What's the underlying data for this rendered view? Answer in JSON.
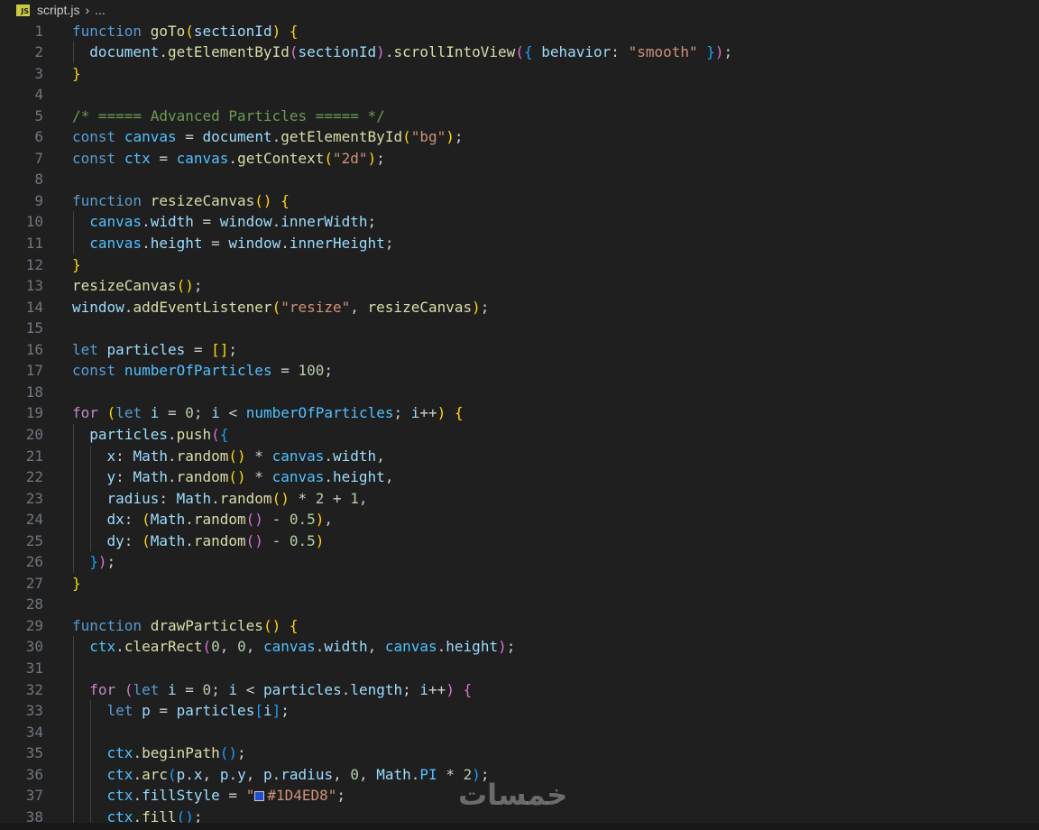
{
  "breadcrumb": {
    "file_icon_label": "JS",
    "file": "script.js",
    "separator": "›",
    "rest": "..."
  },
  "watermark": "خمسات",
  "lines": [
    {
      "n": "1",
      "html": "<span class='k'>function</span> <span class='f'>goTo</span><span class='b1'>(</span><span class='v'>sectionId</span><span class='b1'>)</span> <span class='b1'>{</span>"
    },
    {
      "n": "2",
      "html": "  <span class='v'>document</span>.<span class='f'>getElementById</span><span class='b2'>(</span><span class='v'>sectionId</span><span class='b2'>)</span>.<span class='f'>scrollIntoView</span><span class='b2'>(</span><span class='b3'>{</span> <span class='v'>behavior</span>: <span class='s'>\"smooth\"</span> <span class='b3'>}</span><span class='b2'>)</span>;"
    },
    {
      "n": "3",
      "html": "<span class='b1'>}</span>"
    },
    {
      "n": "4",
      "html": ""
    },
    {
      "n": "5",
      "html": "<span class='cm'>/* ===== Advanced Particles ===== */</span>"
    },
    {
      "n": "6",
      "html": "<span class='k'>const</span> <span class='c'>canvas</span> = <span class='v'>document</span>.<span class='f'>getElementById</span><span class='b1'>(</span><span class='s'>\"bg\"</span><span class='b1'>)</span>;"
    },
    {
      "n": "7",
      "html": "<span class='k'>const</span> <span class='c'>ctx</span> = <span class='c'>canvas</span>.<span class='f'>getContext</span><span class='b1'>(</span><span class='s'>\"2d\"</span><span class='b1'>)</span>;"
    },
    {
      "n": "8",
      "html": ""
    },
    {
      "n": "9",
      "html": "<span class='k'>function</span> <span class='f'>resizeCanvas</span><span class='b1'>()</span> <span class='b1'>{</span>"
    },
    {
      "n": "10",
      "html": "  <span class='c'>canvas</span>.<span class='v'>width</span> = <span class='v'>window</span>.<span class='v'>innerWidth</span>;"
    },
    {
      "n": "11",
      "html": "  <span class='c'>canvas</span>.<span class='v'>height</span> = <span class='v'>window</span>.<span class='v'>innerHeight</span>;"
    },
    {
      "n": "12",
      "html": "<span class='b1'>}</span>"
    },
    {
      "n": "13",
      "html": "<span class='f'>resizeCanvas</span><span class='b1'>()</span>;"
    },
    {
      "n": "14",
      "html": "<span class='v'>window</span>.<span class='f'>addEventListener</span><span class='b1'>(</span><span class='s'>\"resize\"</span>, <span class='f'>resizeCanvas</span><span class='b1'>)</span>;"
    },
    {
      "n": "15",
      "html": ""
    },
    {
      "n": "16",
      "html": "<span class='k'>let</span> <span class='v'>particles</span> = <span class='b1'>[]</span>;"
    },
    {
      "n": "17",
      "html": "<span class='k'>const</span> <span class='c'>numberOfParticles</span> = <span class='n'>100</span>;"
    },
    {
      "n": "18",
      "html": ""
    },
    {
      "n": "19",
      "html": "<span class='kc'>for</span> <span class='b1'>(</span><span class='k'>let</span> <span class='v'>i</span> = <span class='n'>0</span>; <span class='v'>i</span> &lt; <span class='c'>numberOfParticles</span>; <span class='v'>i</span>++<span class='b1'>)</span> <span class='b1'>{</span>"
    },
    {
      "n": "20",
      "html": "  <span class='v'>particles</span>.<span class='f'>push</span><span class='b2'>(</span><span class='b3'>{</span>"
    },
    {
      "n": "21",
      "html": "    <span class='v'>x</span>: <span class='v'>Math</span>.<span class='f'>random</span><span class='b1'>()</span> * <span class='c'>canvas</span>.<span class='v'>width</span>,"
    },
    {
      "n": "22",
      "html": "    <span class='v'>y</span>: <span class='v'>Math</span>.<span class='f'>random</span><span class='b1'>()</span> * <span class='c'>canvas</span>.<span class='v'>height</span>,"
    },
    {
      "n": "23",
      "html": "    <span class='v'>radius</span>: <span class='v'>Math</span>.<span class='f'>random</span><span class='b1'>()</span> * <span class='n'>2</span> + <span class='n'>1</span>,"
    },
    {
      "n": "24",
      "html": "    <span class='v'>dx</span>: <span class='b1'>(</span><span class='v'>Math</span>.<span class='f'>random</span><span class='b2'>()</span> - <span class='n'>0.5</span><span class='b1'>)</span>,"
    },
    {
      "n": "25",
      "html": "    <span class='v'>dy</span>: <span class='b1'>(</span><span class='v'>Math</span>.<span class='f'>random</span><span class='b2'>()</span> - <span class='n'>0.5</span><span class='b1'>)</span>"
    },
    {
      "n": "26",
      "html": "  <span class='b3'>}</span><span class='b2'>)</span>;"
    },
    {
      "n": "27",
      "html": "<span class='b1'>}</span>"
    },
    {
      "n": "28",
      "html": ""
    },
    {
      "n": "29",
      "html": "<span class='k'>function</span> <span class='f'>drawParticles</span><span class='b1'>()</span> <span class='b1'>{</span>"
    },
    {
      "n": "30",
      "html": "  <span class='c'>ctx</span>.<span class='f'>clearRect</span><span class='b2'>(</span><span class='n'>0</span>, <span class='n'>0</span>, <span class='c'>canvas</span>.<span class='v'>width</span>, <span class='c'>canvas</span>.<span class='v'>height</span><span class='b2'>)</span>;"
    },
    {
      "n": "31",
      "html": ""
    },
    {
      "n": "32",
      "html": "  <span class='kc'>for</span> <span class='b2'>(</span><span class='k'>let</span> <span class='v'>i</span> = <span class='n'>0</span>; <span class='v'>i</span> &lt; <span class='v'>particles</span>.<span class='v'>length</span>; <span class='v'>i</span>++<span class='b2'>)</span> <span class='b2'>{</span>"
    },
    {
      "n": "33",
      "html": "    <span class='k'>let</span> <span class='v'>p</span> = <span class='v'>particles</span><span class='b3'>[</span><span class='v'>i</span><span class='b3'>]</span>;"
    },
    {
      "n": "34",
      "html": ""
    },
    {
      "n": "35",
      "html": "    <span class='c'>ctx</span>.<span class='f'>beginPath</span><span class='b3'>()</span>;"
    },
    {
      "n": "36",
      "html": "    <span class='c'>ctx</span>.<span class='f'>arc</span><span class='b3'>(</span><span class='v'>p</span>.<span class='v'>x</span>, <span class='v'>p</span>.<span class='v'>y</span>, <span class='v'>p</span>.<span class='v'>radius</span>, <span class='n'>0</span>, <span class='v'>Math</span>.<span class='c'>PI</span> * <span class='n'>2</span><span class='b3'>)</span>;"
    },
    {
      "n": "37",
      "html": "    <span class='c'>ctx</span>.<span class='v'>fillStyle</span> = <span class='s'>\"<span class='sw' style='background:#1D4ED8'></span>#1D4ED8\"</span>;"
    },
    {
      "n": "38",
      "html": "    <span class='c'>ctx</span>.<span class='f'>fill</span><span class='b3'>()</span>;"
    }
  ]
}
